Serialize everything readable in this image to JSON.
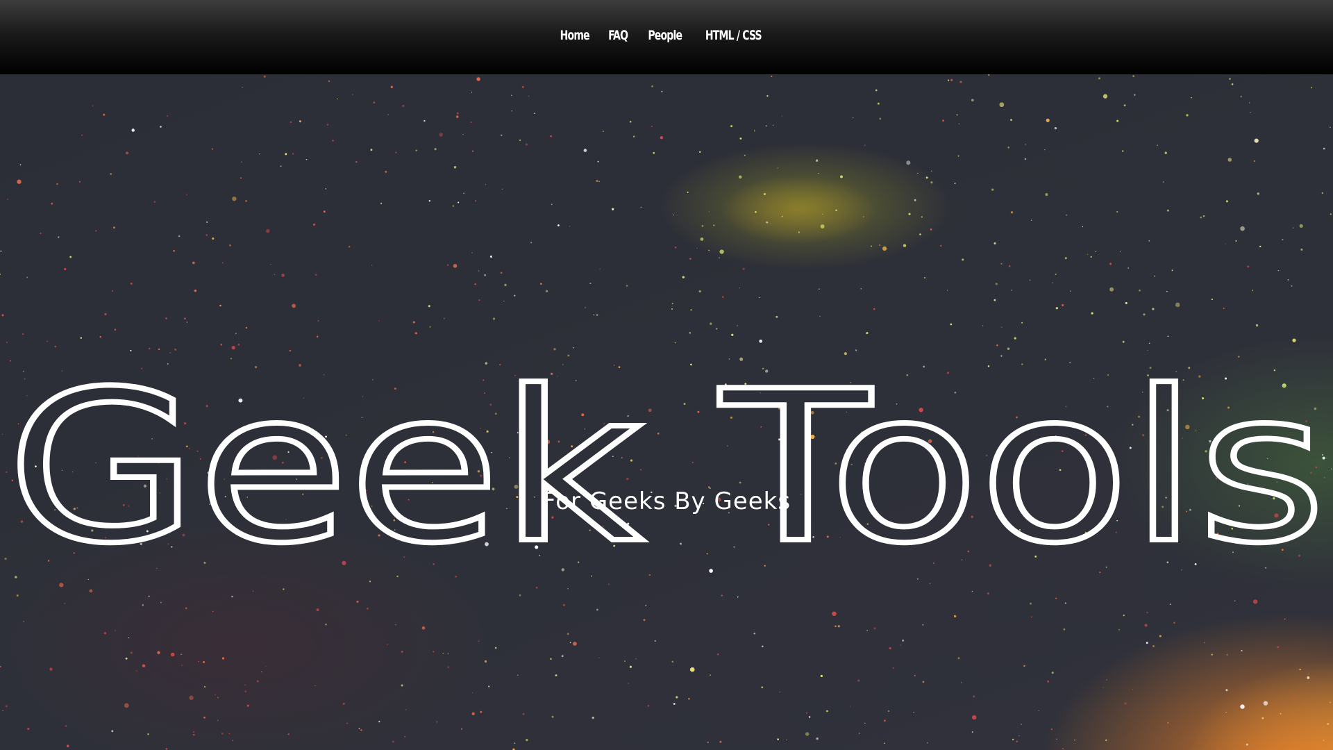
{
  "nav": {
    "items": [
      {
        "label": "Home"
      },
      {
        "label": "FAQ"
      },
      {
        "label": "People"
      },
      {
        "label": "HTML / CSS"
      }
    ]
  },
  "hero": {
    "title": "Geek Tools",
    "subtitle": "For Geeks By Geeks"
  },
  "colors": {
    "navbar": "#000000",
    "text": "#ffffff",
    "background": "#2e3039"
  }
}
